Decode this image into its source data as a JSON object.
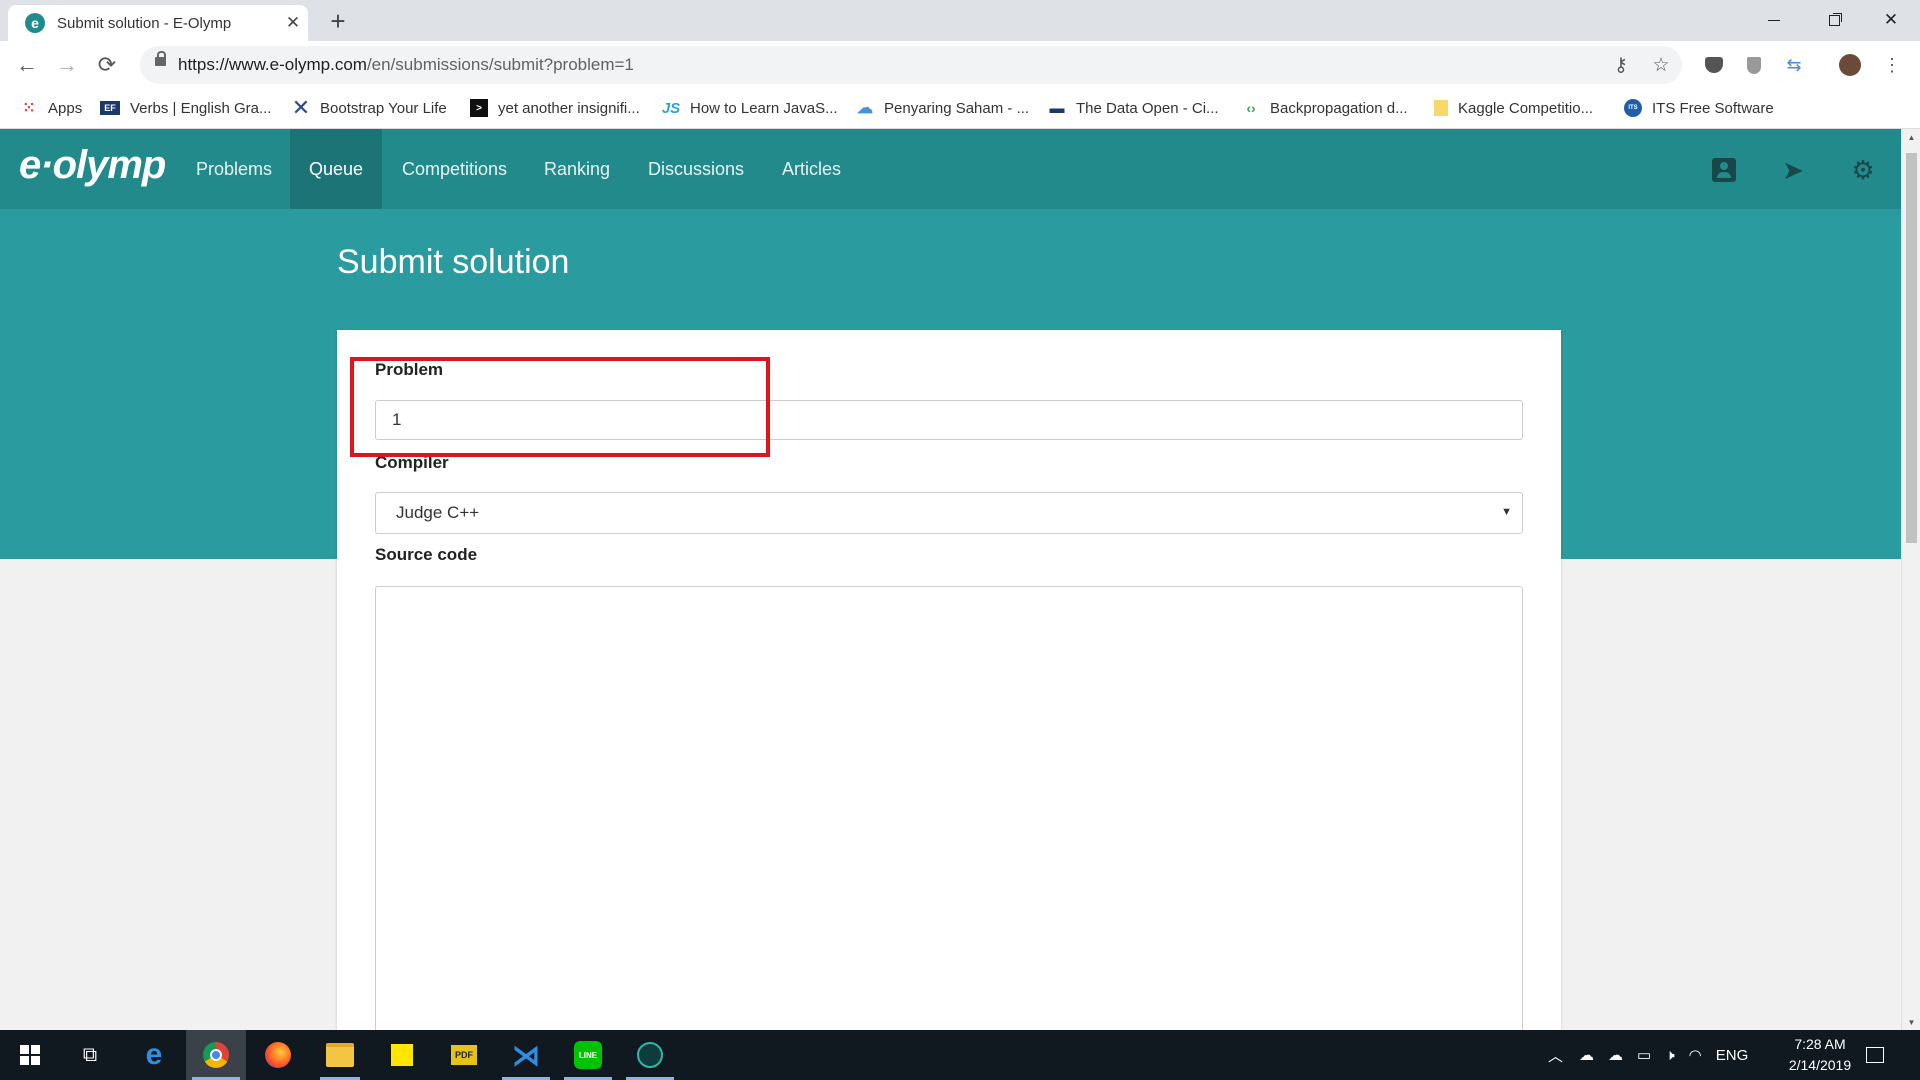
{
  "browser": {
    "tab_title": "Submit solution - E-Olymp",
    "tab_favicon": "e",
    "url_host": "https://www.e-olymp.com",
    "url_path": "/en/submissions/submit?problem=1",
    "new_tab": "+",
    "bookmarks": [
      {
        "label": "Apps",
        "icon": "apps-grid-icon"
      },
      {
        "label": "Verbs | English Gra...",
        "icon": "ef-icon"
      },
      {
        "label": "Bootstrap Your Life",
        "icon": "x-icon"
      },
      {
        "label": "yet another insignifi...",
        "icon": "terminal-icon"
      },
      {
        "label": "How to Learn JavaS...",
        "icon": "js-icon"
      },
      {
        "label": "Penyaring Saham - ...",
        "icon": "cloud-icon"
      },
      {
        "label": "The Data Open - Ci...",
        "icon": "flag-icon"
      },
      {
        "label": "Backpropagation d...",
        "icon": "code-icon"
      },
      {
        "label": "Kaggle Competitio...",
        "icon": "note-icon"
      },
      {
        "label": "ITS Free Software",
        "icon": "its-icon"
      }
    ]
  },
  "site": {
    "logo": "e·olymp",
    "nav": [
      {
        "label": "Problems",
        "active": false
      },
      {
        "label": "Queue",
        "active": true
      },
      {
        "label": "Competitions",
        "active": false
      },
      {
        "label": "Ranking",
        "active": false
      },
      {
        "label": "Discussions",
        "active": false
      },
      {
        "label": "Articles",
        "active": false
      }
    ]
  },
  "page": {
    "title": "Submit solution",
    "form": {
      "problem_label": "Problem",
      "problem_value": "1",
      "compiler_label": "Compiler",
      "compiler_value": "Judge C++",
      "source_label": "Source code",
      "source_value": ""
    }
  },
  "taskbar": {
    "time": "7:28 AM",
    "date": "2/14/2019",
    "language": "ENG"
  },
  "colors": {
    "navbar": "#238a8c",
    "hero": "#2a9c9f",
    "active_nav": "#1d7476",
    "highlight": "#e0141c"
  }
}
